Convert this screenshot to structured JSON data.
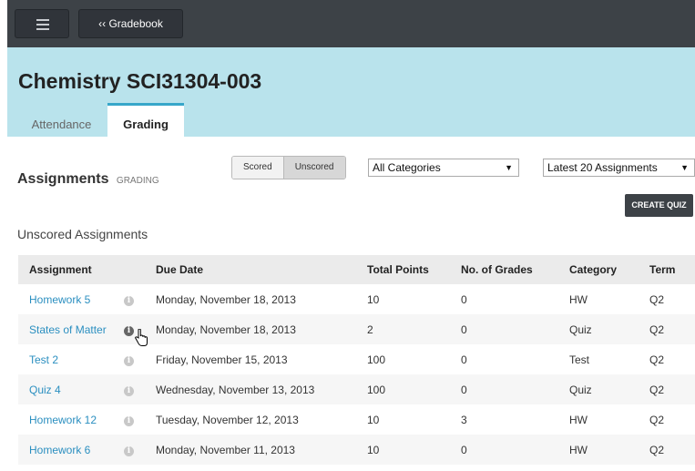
{
  "topbar": {
    "back_label": "‹‹ Gradebook"
  },
  "header": {
    "course_title": "Chemistry SCI31304-003"
  },
  "tabs": [
    {
      "label": "Attendance"
    },
    {
      "label": "Grading"
    }
  ],
  "assignments": {
    "title": "Assignments",
    "subtitle": "GRADING",
    "toggle": {
      "scored": "Scored",
      "unscored": "Unscored",
      "selected": "Unscored"
    },
    "category_filter": "All Categories",
    "range_filter": "Latest 20 Assignments",
    "create_quiz": "CREATE QUIZ"
  },
  "unscored_title": "Unscored Assignments",
  "table": {
    "headers": [
      "Assignment",
      "Due Date",
      "Total Points",
      "No. of Grades",
      "Category",
      "Term"
    ],
    "rows": [
      {
        "name": "Homework 5",
        "due": "Monday, November 18, 2013",
        "points": "10",
        "grades": "0",
        "category": "HW",
        "term": "Q2"
      },
      {
        "name": "States of Matter",
        "due": "Monday, November 18, 2013",
        "points": "2",
        "grades": "0",
        "category": "Quiz",
        "term": "Q2"
      },
      {
        "name": "Test 2",
        "due": "Friday, November 15, 2013",
        "points": "100",
        "grades": "0",
        "category": "Test",
        "term": "Q2"
      },
      {
        "name": "Quiz 4",
        "due": "Wednesday, November 13, 2013",
        "points": "100",
        "grades": "0",
        "category": "Quiz",
        "term": "Q2"
      },
      {
        "name": "Homework 12",
        "due": "Tuesday, November 12, 2013",
        "points": "10",
        "grades": "3",
        "category": "HW",
        "term": "Q2"
      },
      {
        "name": "Homework 6",
        "due": "Monday, November 11, 2013",
        "points": "10",
        "grades": "0",
        "category": "HW",
        "term": "Q2"
      }
    ]
  },
  "icons": {
    "menu": "hamburger-icon",
    "info": "info-icon",
    "caret": "chevron-down-icon",
    "cursor": "hand-pointer-icon"
  },
  "colors": {
    "topbar": "#3d4247",
    "header_bg": "#b9e3ec",
    "link": "#2b8fc0",
    "tab_accent": "#37a6c9"
  }
}
